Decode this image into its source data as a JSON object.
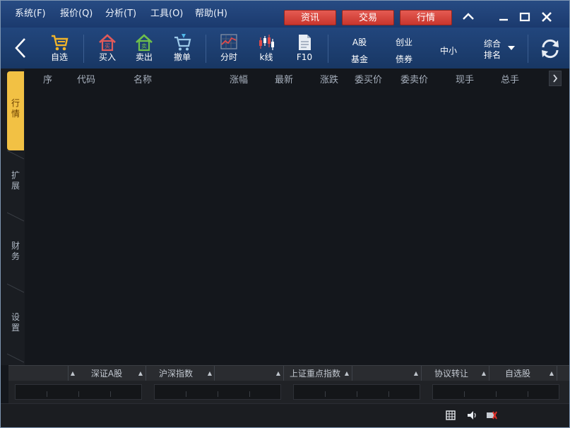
{
  "menu": [
    "系统(F)",
    "报价(Q)",
    "分析(T)",
    "工具(O)",
    "帮助(H)"
  ],
  "top_buttons": [
    "资讯",
    "交易",
    "行情"
  ],
  "toolbar": {
    "buy_label": "自选",
    "trade_buy": "买入",
    "trade_sell": "卖出",
    "cancel_order": "撤单",
    "timeshare": "分时",
    "kline": "k线",
    "f10": "F10"
  },
  "market": {
    "a_share": "A股",
    "fund": "基金",
    "chuangye": "创业",
    "bond": "债券",
    "zhongxiao": "中小",
    "rank_line1": "综合",
    "rank_line2": "排名"
  },
  "side_tabs": [
    {
      "label": "行\n情",
      "active": true
    },
    {
      "label": "扩\n展",
      "active": false
    },
    {
      "label": "财\n务",
      "active": false
    },
    {
      "label": "设\n置",
      "active": false
    }
  ],
  "columns": [
    "序",
    "代码",
    "名称",
    "涨幅",
    "最新",
    "涨跌",
    "委买价",
    "委卖价",
    "现手",
    "总手"
  ],
  "bottom_tabs": [
    "深证A股",
    "沪深指数",
    "上证重点指数",
    "协议转让",
    "自选股"
  ],
  "colors": {
    "accent_red": "#d6443b",
    "active_tab": "#f2c144",
    "titlebar": "#22467d"
  }
}
